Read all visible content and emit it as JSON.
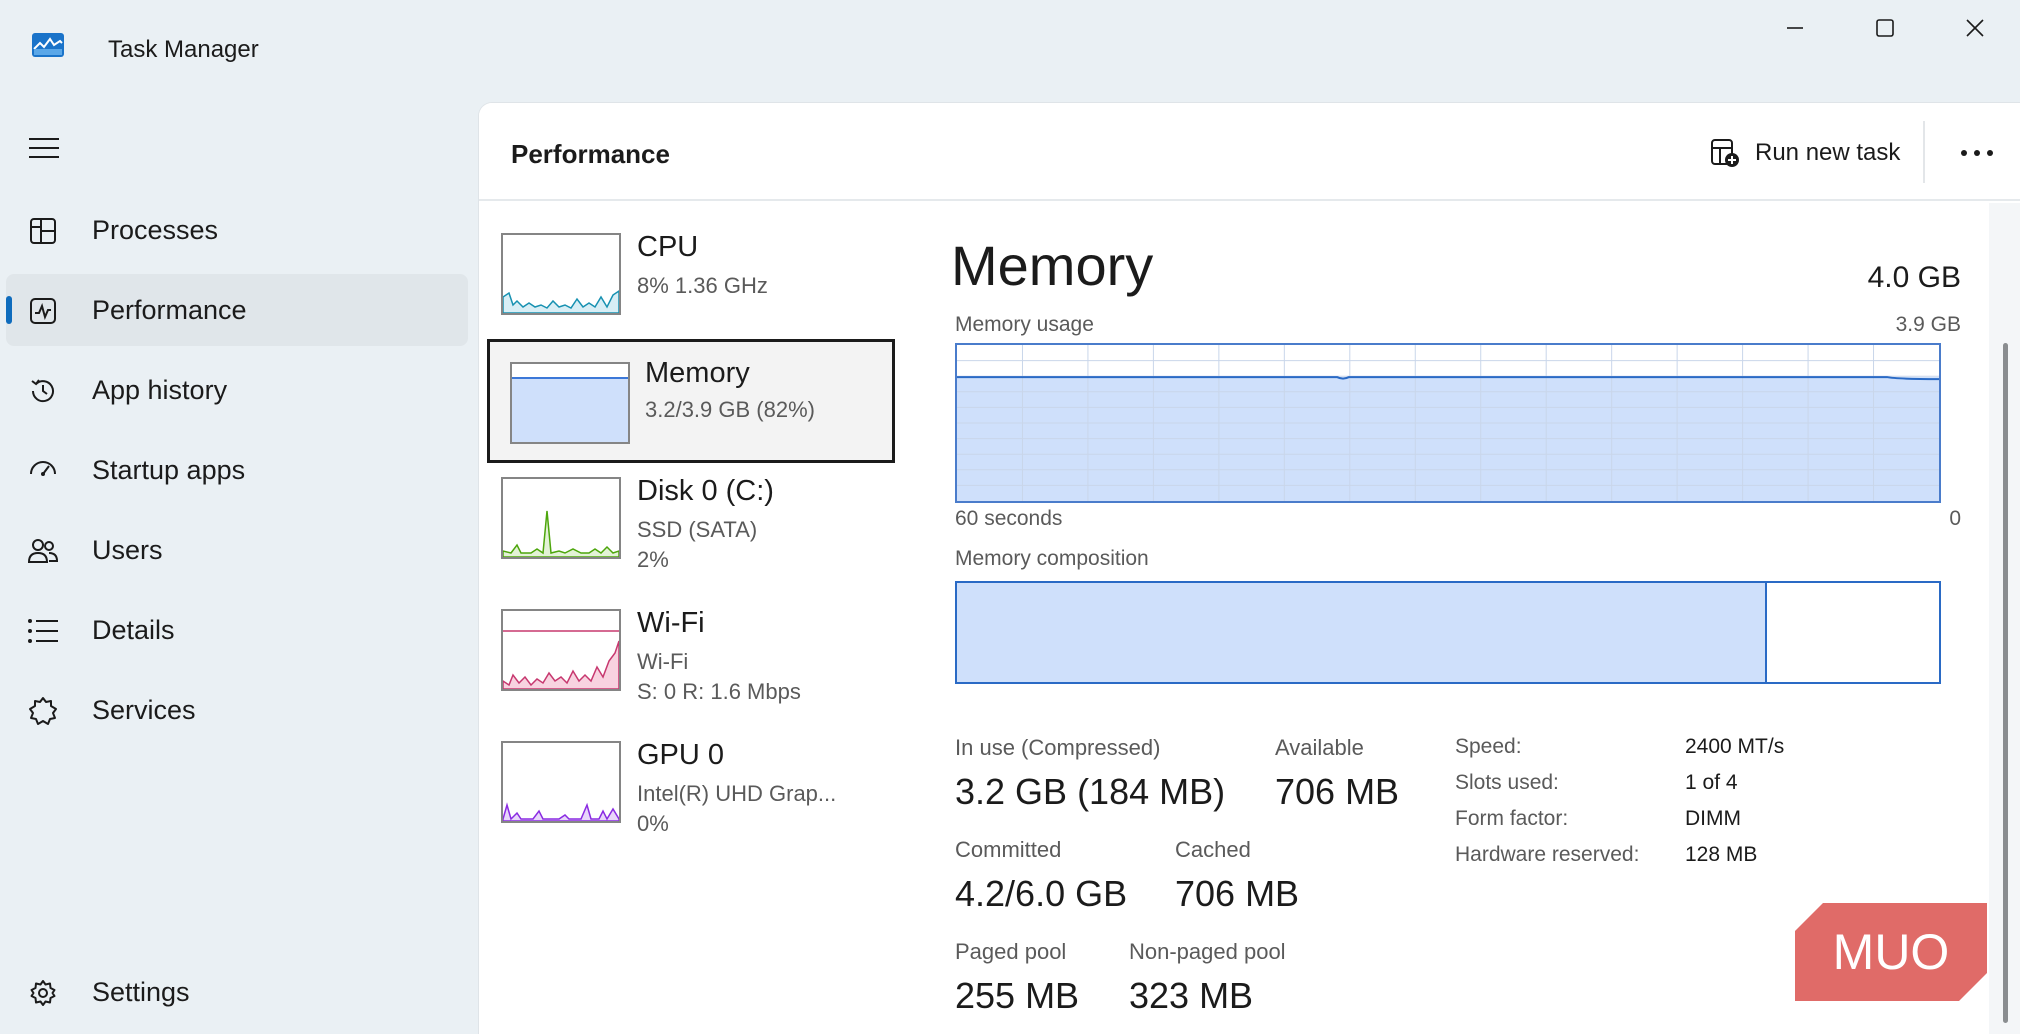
{
  "window": {
    "title": "Task Manager",
    "controls": {
      "minimize_icon": "minimize-icon",
      "maximize_icon": "maximize-icon",
      "close_icon": "close-icon"
    }
  },
  "sidebar": {
    "menu_icon": "hamburger-icon",
    "items": [
      {
        "label": "Processes",
        "icon": "processes-icon",
        "active": false
      },
      {
        "label": "Performance",
        "icon": "performance-icon",
        "active": true
      },
      {
        "label": "App history",
        "icon": "history-icon",
        "active": false
      },
      {
        "label": "Startup apps",
        "icon": "startup-icon",
        "active": false
      },
      {
        "label": "Users",
        "icon": "users-icon",
        "active": false
      },
      {
        "label": "Details",
        "icon": "details-icon",
        "active": false
      },
      {
        "label": "Services",
        "icon": "services-icon",
        "active": false
      }
    ],
    "settings": {
      "label": "Settings",
      "icon": "gear-icon"
    }
  },
  "header": {
    "title": "Performance",
    "run_task_label": "Run new task",
    "more_icon": "more-icon"
  },
  "devices": [
    {
      "name": "CPU",
      "sub1": "8%  1.36 GHz",
      "sub2": "",
      "color": "#1791b1",
      "selected": false
    },
    {
      "name": "Memory",
      "sub1": "3.2/3.9 GB (82%)",
      "sub2": "",
      "color": "#3c78d8",
      "selected": true
    },
    {
      "name": "Disk 0 (C:)",
      "sub1": "SSD (SATA)",
      "sub2": "2%",
      "color": "#4da60c",
      "selected": false
    },
    {
      "name": "Wi-Fi",
      "sub1": "Wi-Fi",
      "sub2": "S: 0  R: 1.6 Mbps",
      "color": "#c7386f",
      "selected": false
    },
    {
      "name": "GPU 0",
      "sub1": "Intel(R) UHD Grap...",
      "sub2": "0%",
      "color": "#8a2be2",
      "selected": false
    }
  ],
  "memory": {
    "title": "Memory",
    "total": "4.0 GB",
    "usage_label": "Memory usage",
    "usage_max": "3.9 GB",
    "time_label": "60 seconds",
    "time_end": "0",
    "usage_fraction": 0.82,
    "composition_label": "Memory composition",
    "composition_in_use_fraction": 0.825,
    "stats": {
      "in_use_label": "In use (Compressed)",
      "in_use_value": "3.2 GB (184 MB)",
      "available_label": "Available",
      "available_value": "706 MB",
      "committed_label": "Committed",
      "committed_value": "4.2/6.0 GB",
      "cached_label": "Cached",
      "cached_value": "706 MB",
      "paged_label": "Paged pool",
      "paged_value": "255 MB",
      "nonpaged_label": "Non-paged pool",
      "nonpaged_value": "323 MB"
    },
    "specs": [
      {
        "key": "Speed:",
        "value": "2400 MT/s"
      },
      {
        "key": "Slots used:",
        "value": "1 of 4"
      },
      {
        "key": "Form factor:",
        "value": "DIMM"
      },
      {
        "key": "Hardware reserved:",
        "value": "128 MB"
      }
    ],
    "accent": "#2a6ac5",
    "fill": "#cfe0fb"
  },
  "watermark": "MUO"
}
